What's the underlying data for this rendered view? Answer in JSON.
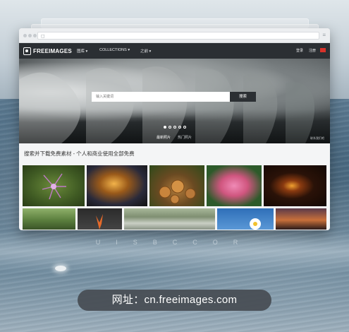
{
  "site": {
    "logo_text": "FREEIMAGES",
    "nav": [
      "图库 ▾",
      "COLLECTIONS ▾",
      "之前 ▾"
    ],
    "nav_right": [
      "登录",
      "注册"
    ],
    "search_placeholder": "输入关键词",
    "search_button": "搜索",
    "hero_tabs": [
      "最新照片",
      "热门照片"
    ],
    "hero_credit": "联系我们吧",
    "heading": "搜索并下载免费素材 - 个人和商业使用全部免费"
  },
  "colors": {
    "nav_bg": "#2b2f33",
    "flag": "#d8322a",
    "pill_bg": "#464c52"
  },
  "thumbnails_row1": [
    "purple-flower",
    "lightning-sky",
    "coins",
    "pink-lily",
    "candle"
  ],
  "thumbnails_row2": [
    "people-park",
    "orange-plant",
    "river-rocks",
    "daisy-sky",
    "sunset-tree"
  ],
  "carousel": {
    "count": 5,
    "active": 1
  },
  "tagline": "UISBCCOR",
  "url_pill": "网址：cn.freeimages.com"
}
